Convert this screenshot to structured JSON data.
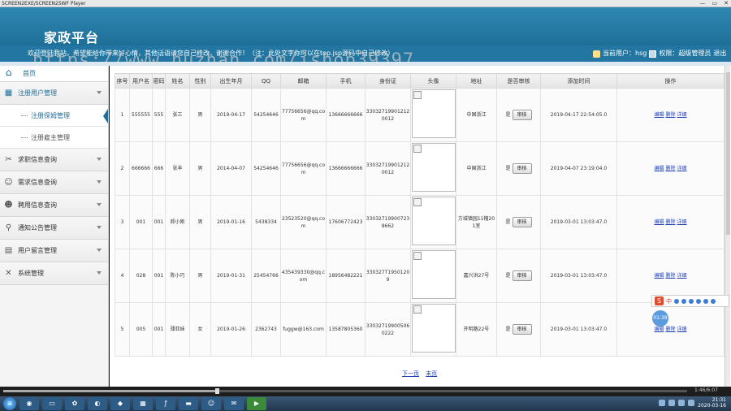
{
  "window": {
    "title": "SCREEN2EXE/SCREEN2SWF Player",
    "min": "—",
    "max": "▭",
    "close": "✕"
  },
  "header": {
    "brand": "家政平台"
  },
  "infobar": {
    "marquee": "欢迎登陆我站，希望能给你带来好心情，其他话语请您自己修改，谢谢合作！（注：此处文字你可以在top.jsp源码中自己修改）",
    "current_user_label": "当前用户：hsg",
    "role_label": "权限：超级管理员",
    "role_suffix": "退出"
  },
  "watermark": "https://www.huzhan.com/ishop39397",
  "sidebar": {
    "home": "首页",
    "items": [
      {
        "label": "注册用户管理",
        "icon": "grid-icon",
        "expanded": true,
        "subitems": [
          "注册保姆管理",
          "注册雇主管理"
        ]
      },
      {
        "label": "求职信息查询",
        "icon": "tools-icon"
      },
      {
        "label": "需求信息查询",
        "icon": "person-icon"
      },
      {
        "label": "聘用信息查询",
        "icon": "person-icon"
      },
      {
        "label": "通知公告管理",
        "icon": "search-icon"
      },
      {
        "label": "用户留言管理",
        "icon": "document-icon"
      },
      {
        "label": "系统管理",
        "icon": "wrench-icon"
      }
    ]
  },
  "table": {
    "headers": [
      "序号",
      "用户名",
      "密码",
      "姓名",
      "性别",
      "出生年月",
      "QQ",
      "邮箱",
      "手机",
      "身份证",
      "头像",
      "地址",
      "是否审核",
      "添加时间",
      "操作"
    ],
    "rows": [
      {
        "no": "1",
        "username": "555555",
        "password": "555",
        "name": "张三",
        "gender": "男",
        "birth": "2019-04-17",
        "qq": "54254646",
        "email": "77756656@qq.com",
        "phone": "13666666666",
        "idcard": "330327199012120012",
        "address": "中国浙江",
        "audited": "是",
        "added": "2019-04-17 22:54:05.0"
      },
      {
        "no": "2",
        "username": "666666",
        "password": "666",
        "name": "张丰",
        "gender": "男",
        "birth": "2014-04-07",
        "qq": "54254646",
        "email": "77756656@qq.com",
        "phone": "13666666666",
        "idcard": "330327199012120012",
        "address": "中国浙江",
        "audited": "是",
        "added": "2019-04-07 23:19:04.0"
      },
      {
        "no": "3",
        "username": "001",
        "password": "001",
        "name": "郝小刚",
        "gender": "男",
        "birth": "2019-01-16",
        "qq": "5438334",
        "email": "23523520@qq.com",
        "phone": "17606772423",
        "idcard": "330327199007238662",
        "address": "方城镇园11幢201室",
        "audited": "是",
        "added": "2019-03-01 13:03:47.0"
      },
      {
        "no": "4",
        "username": "028",
        "password": "001",
        "name": "陈小巧",
        "gender": "男",
        "birth": "2019-01-31",
        "qq": "25454766",
        "email": "435439330@qq.com",
        "phone": "18956482221",
        "idcard": "330327T19501209",
        "address": "嘉兴洪27号",
        "audited": "是",
        "added": "2019-03-01 13:03:47.0"
      },
      {
        "no": "5",
        "username": "005",
        "password": "001",
        "name": "薄亚妹",
        "gender": "女",
        "birth": "2019-01-26",
        "qq": "2362743",
        "email": "fuggw@163.com",
        "phone": "13587805360",
        "idcard": "330327199005060222",
        "address": "开明路22号",
        "audited": "是",
        "added": "2019-03-01 13:03:47.0"
      }
    ],
    "audit_button": "审核",
    "ops": [
      "编辑",
      "删除",
      "详细"
    ]
  },
  "pager": {
    "next": "下一页",
    "last": "末页"
  },
  "ime": {
    "label": "中"
  },
  "floatclock": "01:38",
  "player": {
    "time": "1:46/6:07"
  },
  "taskbar": {
    "clock_time": "21:31",
    "clock_date": "2020-03-16"
  }
}
